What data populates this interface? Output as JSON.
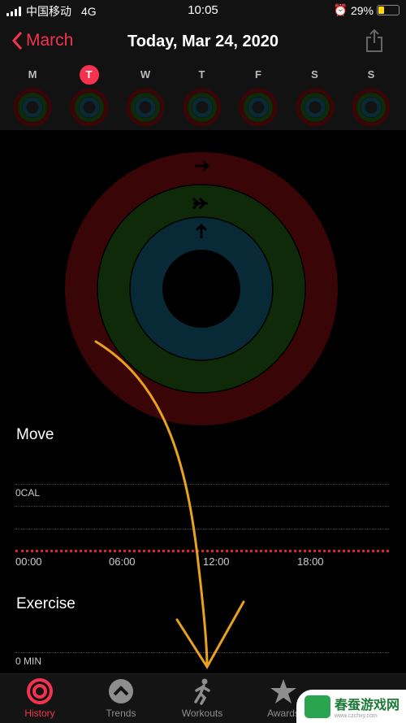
{
  "status": {
    "carrier": "中国移动",
    "network": "4G",
    "time": "10:05",
    "battery": "29%",
    "battery_level": 0.29
  },
  "nav": {
    "back_label": "March",
    "title": "Today, Mar 24, 2020"
  },
  "week": {
    "days": [
      "M",
      "T",
      "W",
      "T",
      "F",
      "S",
      "S"
    ],
    "selected_index": 1
  },
  "rings": {
    "move_color": "#3a0506",
    "exercise_color": "#0e2a08",
    "stand_color": "#082a36",
    "move_progress": 0,
    "exercise_progress": 0,
    "stand_progress": 0
  },
  "move": {
    "label": "Move",
    "value": "0CAL",
    "ticks": [
      "00:00",
      "06:00",
      "12:00",
      "18:00"
    ]
  },
  "exercise": {
    "label": "Exercise",
    "value": "0 MIN"
  },
  "tabs": [
    {
      "label": "History"
    },
    {
      "label": "Trends"
    },
    {
      "label": "Workouts"
    },
    {
      "label": "Awards"
    }
  ],
  "watermark": {
    "name": "春蚕游戏网",
    "url": "www.czchxy.com"
  }
}
